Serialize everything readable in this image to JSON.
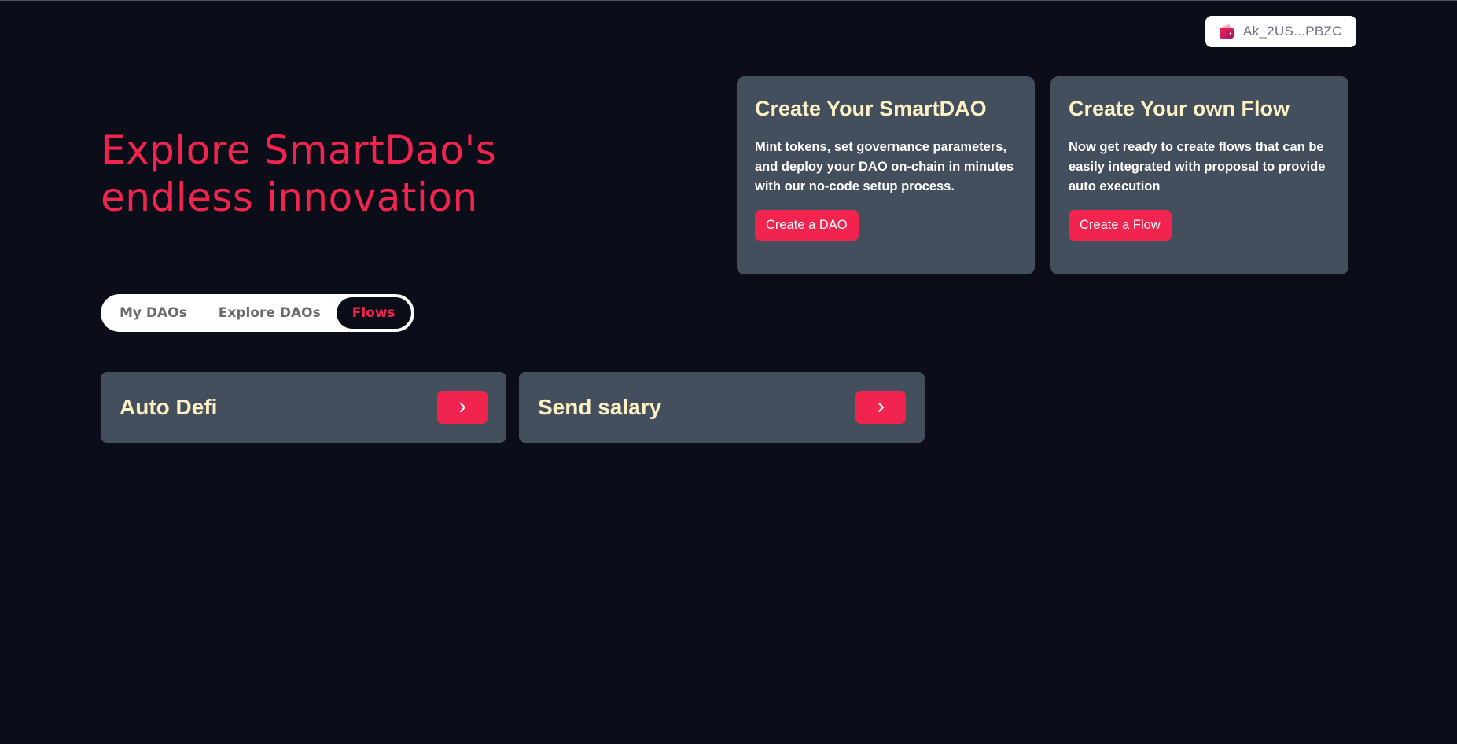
{
  "header": {
    "wallet": {
      "address": "Ak_2US...PBZC",
      "icon": "wallet-icon"
    }
  },
  "hero": {
    "title": "Explore SmartDao's endless innovation"
  },
  "cards": {
    "create_dao": {
      "title": "Create Your SmartDAO",
      "description": "Mint tokens, set governance parameters, and deploy your DAO on-chain in minutes with our no-code setup process.",
      "button_label": "Create a DAO"
    },
    "create_flow": {
      "title": "Create Your own Flow",
      "description": "Now get ready to create flows that can be easily integrated with proposal to provide auto execution",
      "button_label": "Create a Flow"
    }
  },
  "tabs": [
    {
      "label": "My DAOs",
      "active": false
    },
    {
      "label": "Explore DAOs",
      "active": false
    },
    {
      "label": "Flows",
      "active": true
    }
  ],
  "flows": [
    {
      "name": "Auto Defi",
      "icon": "chevron-right-icon"
    },
    {
      "name": "Send salary",
      "icon": "chevron-right-icon"
    }
  ],
  "colors": {
    "background": "#0b0d18",
    "accent": "#f0244f",
    "card": "#444f5d",
    "card_title": "#fdf0c4"
  }
}
